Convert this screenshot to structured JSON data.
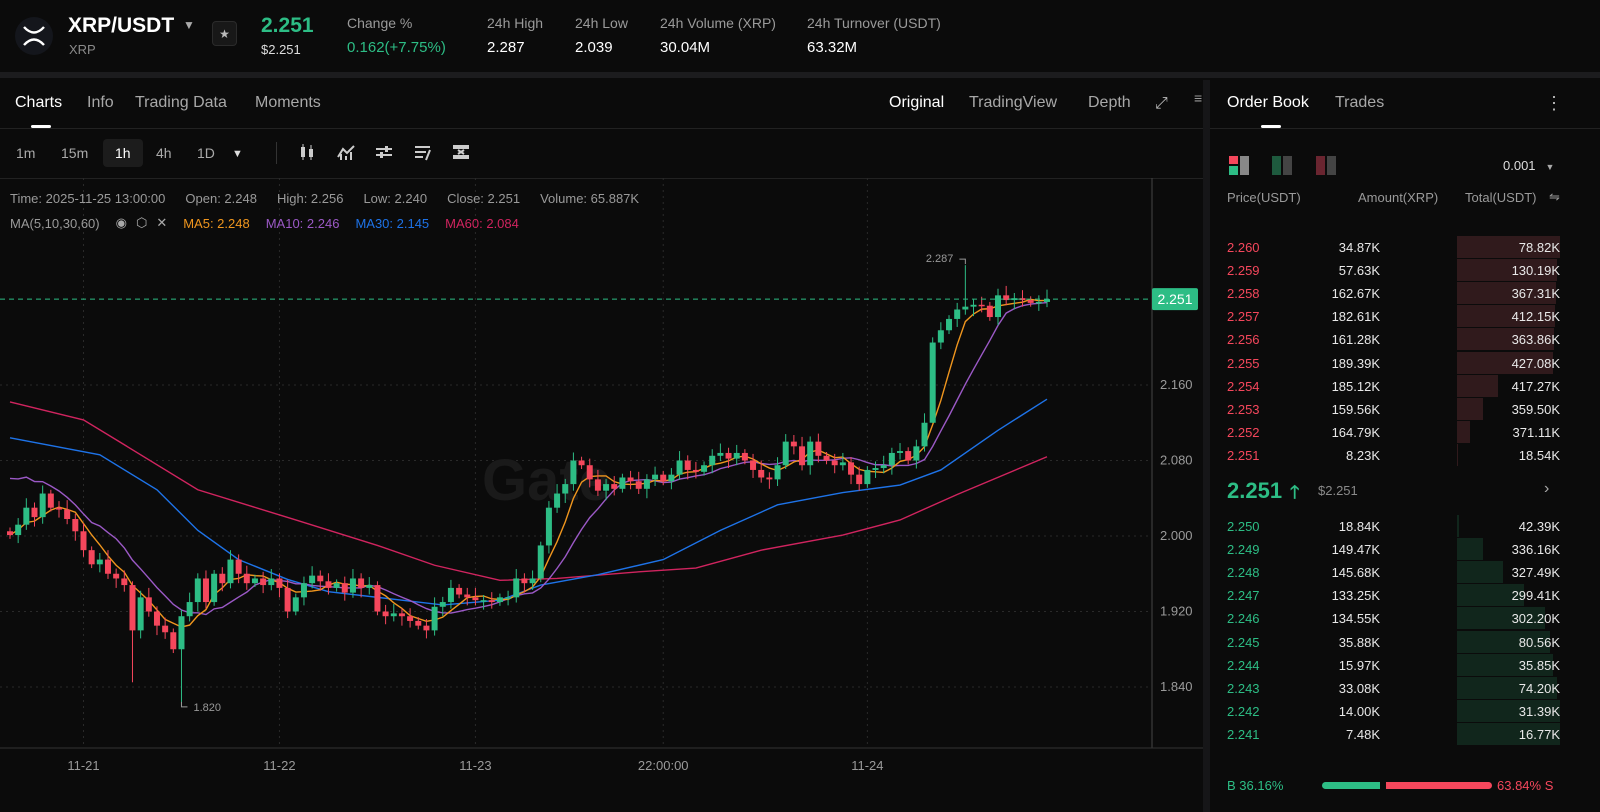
{
  "header": {
    "pair": "XRP/USDT",
    "base": "XRP",
    "last_price": "2.251",
    "last_price_usd": "$2.251",
    "stats": [
      {
        "label": "Change %",
        "value": "0.162(+7.75%)",
        "color": "#2dbd85"
      },
      {
        "label": "24h High",
        "value": "2.287"
      },
      {
        "label": "24h Low",
        "value": "2.039"
      },
      {
        "label": "24h Volume (XRP)",
        "value": "30.04M"
      },
      {
        "label": "24h Turnover (USDT)",
        "value": "63.32M"
      }
    ]
  },
  "left_tabs": [
    "Charts",
    "Info",
    "Trading Data",
    "Moments"
  ],
  "view_tabs": [
    "Original",
    "TradingView",
    "Depth"
  ],
  "timeframes": [
    "1m",
    "15m",
    "1h",
    "4h",
    "1D"
  ],
  "selected_timeframe": "1h",
  "ohlc_info": {
    "time": "Time: 2025-11-25 13:00:00",
    "open": "Open: 2.248",
    "high": "High: 2.256",
    "low": "Low: 2.240",
    "close": "Close: 2.251",
    "volume": "Volume: 65.887K"
  },
  "ma_info": {
    "label": "MA(5,10,30,60)",
    "ma5": "MA5: 2.248",
    "ma10": "MA10: 2.246",
    "ma30": "MA30: 2.145",
    "ma60": "MA60: 2.084"
  },
  "colors": {
    "up": "#2dbd85",
    "down": "#f5475c",
    "ma5": "#f0961e",
    "ma10": "#9b59c6",
    "ma30": "#1e73e8",
    "ma60": "#d0245f"
  },
  "chart_data": {
    "type": "candlestick",
    "watermark": "Gate",
    "ylim": [
      1.76,
      2.35
    ],
    "y_ticks": [
      "2.160",
      "2.080",
      "2.000",
      "1.920",
      "1.840"
    ],
    "x_labels": [
      {
        "label": "11-21",
        "index": 9
      },
      {
        "label": "11-22",
        "index": 33
      },
      {
        "label": "11-23",
        "index": 57
      },
      {
        "label": "22:00:00",
        "index": 80
      },
      {
        "label": "11-24",
        "index": 105
      }
    ],
    "current_price": "2.251",
    "high_marker": {
      "label": "2.287",
      "index": 117,
      "value": 2.287
    },
    "low_marker": {
      "label": "1.820",
      "index": 21,
      "value": 1.82
    },
    "closes": [
      2.001,
      2.012,
      2.03,
      2.02,
      2.045,
      2.03,
      2.028,
      2.018,
      2.005,
      1.985,
      1.97,
      1.975,
      1.96,
      1.955,
      1.948,
      1.9,
      1.935,
      1.92,
      1.905,
      1.898,
      1.88,
      1.915,
      1.93,
      1.955,
      1.93,
      1.96,
      1.95,
      1.975,
      1.96,
      1.95,
      1.955,
      1.948,
      1.955,
      1.945,
      1.92,
      1.935,
      1.95,
      1.958,
      1.952,
      1.945,
      1.95,
      1.94,
      1.955,
      1.945,
      1.948,
      1.92,
      1.915,
      1.918,
      1.915,
      1.91,
      1.905,
      1.9,
      1.925,
      1.93,
      1.945,
      1.938,
      1.935,
      1.932,
      1.932,
      1.93,
      1.935,
      1.935,
      1.955,
      1.95,
      1.955,
      1.99,
      2.03,
      2.045,
      2.055,
      2.08,
      2.075,
      2.06,
      2.048,
      2.055,
      2.05,
      2.062,
      2.058,
      2.05,
      2.06,
      2.065,
      2.058,
      2.065,
      2.08,
      2.07,
      2.068,
      2.075,
      2.085,
      2.088,
      2.082,
      2.088,
      2.08,
      2.07,
      2.062,
      2.06,
      2.075,
      2.1,
      2.095,
      2.075,
      2.1,
      2.085,
      2.08,
      2.075,
      2.078,
      2.065,
      2.055,
      2.07,
      2.072,
      2.075,
      2.088,
      2.09,
      2.08,
      2.095,
      2.12,
      2.205,
      2.218,
      2.23,
      2.24,
      2.243,
      2.245,
      2.244,
      2.232,
      2.255,
      2.25,
      2.252,
      2.25,
      2.247,
      2.248,
      2.251
    ],
    "first_open": 2.005,
    "extremes": [
      {
        "index": 15,
        "low": 1.845
      },
      {
        "index": 21,
        "low": 1.82
      },
      {
        "index": 117,
        "high": 2.287
      },
      {
        "index": 95,
        "high": 2.108
      },
      {
        "index": 113,
        "low": 2.12
      }
    ],
    "ma30": [
      [
        0,
        2.104
      ],
      [
        11,
        2.086
      ],
      [
        18,
        2.049
      ],
      [
        23,
        2.006
      ],
      [
        28,
        1.975
      ],
      [
        34,
        1.954
      ],
      [
        39,
        1.941
      ],
      [
        48,
        1.932
      ],
      [
        53,
        1.927
      ],
      [
        60,
        1.932
      ],
      [
        65,
        1.948
      ],
      [
        72,
        1.959
      ],
      [
        80,
        1.975
      ],
      [
        87,
        2.006
      ],
      [
        94,
        2.033
      ],
      [
        102,
        2.046
      ],
      [
        109,
        2.054
      ],
      [
        114,
        2.07
      ],
      [
        121,
        2.112
      ],
      [
        127,
        2.145
      ]
    ],
    "ma60": [
      [
        0,
        2.142
      ],
      [
        9,
        2.123
      ],
      [
        13,
        2.102
      ],
      [
        23,
        2.049
      ],
      [
        35,
        2.017
      ],
      [
        45,
        1.99
      ],
      [
        52,
        1.969
      ],
      [
        60,
        1.953
      ],
      [
        67,
        1.955
      ],
      [
        77,
        1.962
      ],
      [
        84,
        1.966
      ],
      [
        92,
        1.985
      ],
      [
        102,
        2.001
      ],
      [
        109,
        2.017
      ],
      [
        116,
        2.044
      ],
      [
        127,
        2.084
      ]
    ]
  },
  "orderbook": {
    "tabs": [
      "Order Book",
      "Trades"
    ],
    "precision": "0.001",
    "columns": [
      "Price(USDT)",
      "Amount(XRP)",
      "Total(USDT)"
    ],
    "asks": [
      {
        "p": "2.260",
        "a": "34.87K",
        "t": "78.82K",
        "depth": 1.0
      },
      {
        "p": "2.259",
        "a": "57.63K",
        "t": "130.19K",
        "depth": 0.97
      },
      {
        "p": "2.258",
        "a": "162.67K",
        "t": "367.31K",
        "depth": 0.96
      },
      {
        "p": "2.257",
        "a": "182.61K",
        "t": "412.15K",
        "depth": 0.95
      },
      {
        "p": "2.256",
        "a": "161.28K",
        "t": "363.86K",
        "depth": 0.94
      },
      {
        "p": "2.255",
        "a": "189.39K",
        "t": "427.08K",
        "depth": 0.93
      },
      {
        "p": "2.254",
        "a": "185.12K",
        "t": "417.27K",
        "depth": 0.4
      },
      {
        "p": "2.253",
        "a": "159.56K",
        "t": "359.50K",
        "depth": 0.25
      },
      {
        "p": "2.252",
        "a": "164.79K",
        "t": "371.11K",
        "depth": 0.13
      },
      {
        "p": "2.251",
        "a": "8.23K",
        "t": "18.54K",
        "depth": 0.01
      }
    ],
    "mid_price": "2.251",
    "mid_price_usd": "$2.251",
    "bids": [
      {
        "p": "2.250",
        "a": "18.84K",
        "t": "42.39K",
        "depth": 0.02
      },
      {
        "p": "2.249",
        "a": "149.47K",
        "t": "336.16K",
        "depth": 0.25
      },
      {
        "p": "2.248",
        "a": "145.68K",
        "t": "327.49K",
        "depth": 0.45
      },
      {
        "p": "2.247",
        "a": "133.25K",
        "t": "299.41K",
        "depth": 0.65
      },
      {
        "p": "2.246",
        "a": "134.55K",
        "t": "302.20K",
        "depth": 0.85
      },
      {
        "p": "2.245",
        "a": "35.88K",
        "t": "80.56K",
        "depth": 0.9
      },
      {
        "p": "2.244",
        "a": "15.97K",
        "t": "35.85K",
        "depth": 0.93
      },
      {
        "p": "2.243",
        "a": "33.08K",
        "t": "74.20K",
        "depth": 0.97
      },
      {
        "p": "2.242",
        "a": "14.00K",
        "t": "31.39K",
        "depth": 1.0
      },
      {
        "p": "2.241",
        "a": "7.48K",
        "t": "16.77K",
        "depth": 1.0
      }
    ],
    "buy_label": "B 36.16%",
    "sell_label": "63.84% S",
    "buy_ratio": 0.3616
  }
}
